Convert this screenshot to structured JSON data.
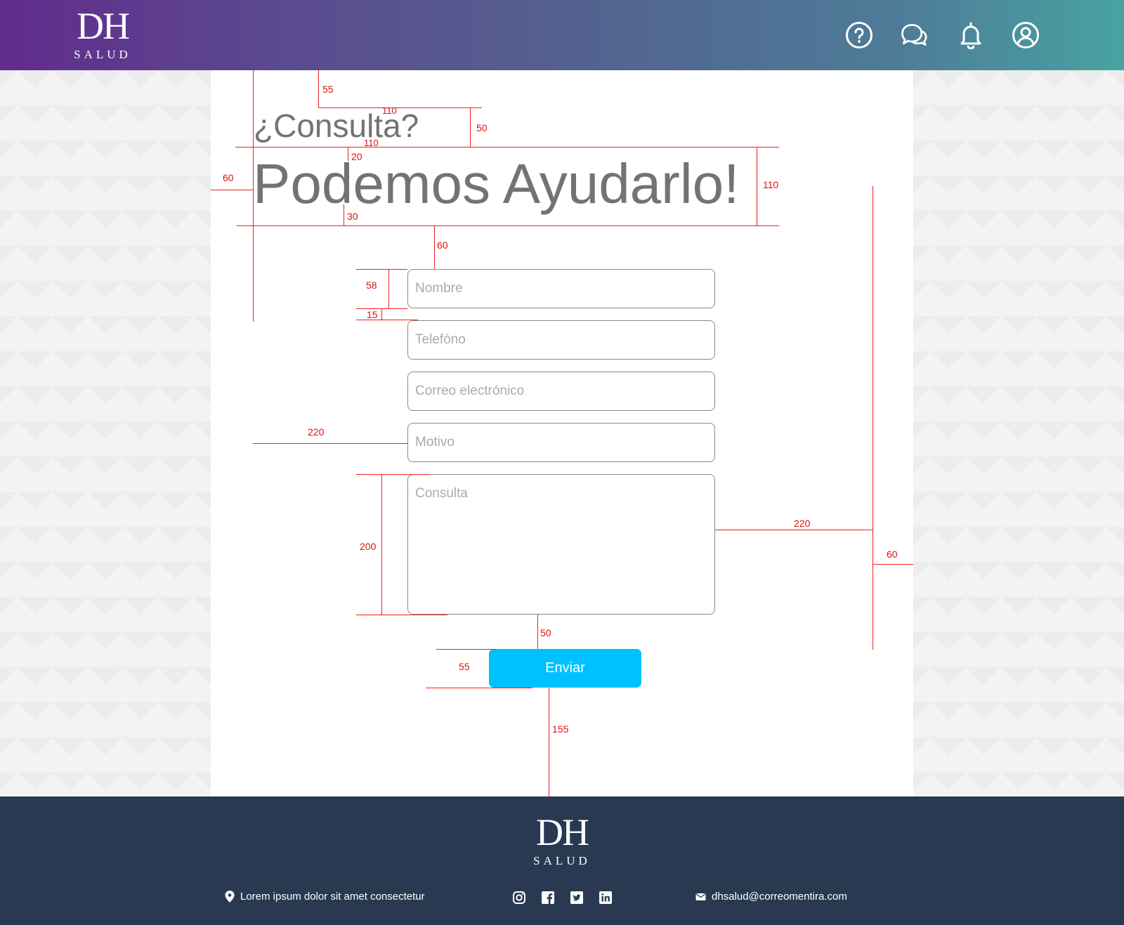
{
  "header": {
    "logo": {
      "main": "DH",
      "sub": "SALUD"
    },
    "icons": [
      "help-icon",
      "chat-icon",
      "bell-icon",
      "user-icon"
    ]
  },
  "form": {
    "pre_title": "¿Consulta?",
    "title": "Podemos Ayudarlo!",
    "fields": {
      "name": "Nombre",
      "phone": "Telefóno",
      "email": "Correo electrónico",
      "reason": "Motivo",
      "query": "Consulta"
    },
    "submit_label": "Enviar"
  },
  "annotations": {
    "a55_top": "55",
    "a110_a": "110",
    "a50_top": "50",
    "a110_b": "110",
    "a20": "20",
    "a60_left": "60",
    "a110_right": "110",
    "a30": "30",
    "a60_mid": "60",
    "a58": "58",
    "a15": "15",
    "a220_left": "220",
    "a200": "200",
    "a220_right": "220",
    "a60_right": "60",
    "a50_btn": "50",
    "a55_btn": "55",
    "a155": "155"
  },
  "footer": {
    "logo": {
      "main": "DH",
      "sub": "SALUD"
    },
    "address": "Lorem ipsum dolor sit amet consectetur",
    "social": [
      "instagram-icon",
      "facebook-icon",
      "twitter-icon",
      "linkedin-icon"
    ],
    "email": "dhsalud@correomentira.com"
  },
  "colors": {
    "header_gradient_start": "#612b8c",
    "header_gradient_end": "#48a3a2",
    "button": "#00c1ff",
    "footer": "#293952",
    "annotation": "#ee2020"
  }
}
